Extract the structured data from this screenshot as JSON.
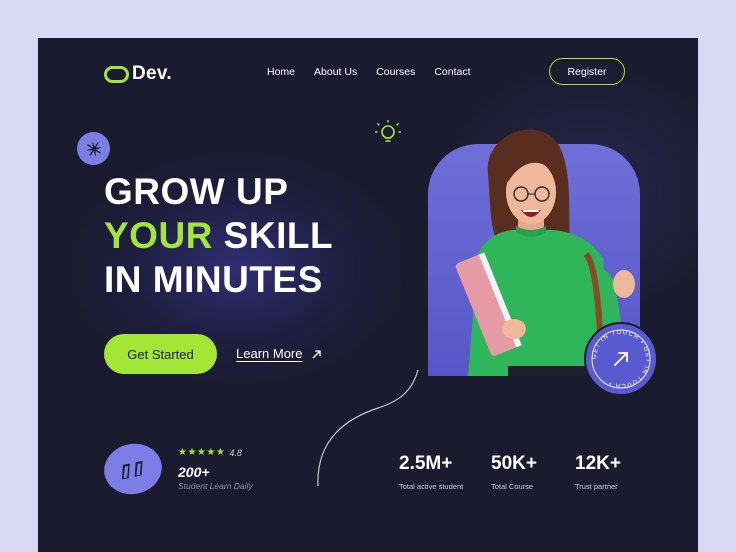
{
  "header": {
    "logo_text": "Dev.",
    "nav": [
      "Home",
      "About Us",
      "Courses",
      "Contact"
    ],
    "register_label": "Register"
  },
  "hero": {
    "line1": "GROW UP",
    "line2_accent": "YOUR",
    "line2_rest": " SKILL",
    "line3": "IN MINUTES",
    "cta_label": "Get Started",
    "learn_label": "Learn More",
    "badge_text": "GET IN TOUCH • GET IN TOUCH •"
  },
  "social_proof": {
    "stars": "★★★★★",
    "rating": "4.8",
    "count": "200+",
    "label": "Student Learn Daily"
  },
  "stats": [
    {
      "value": "2.5M+",
      "label": "Total active student"
    },
    {
      "value": "50K+",
      "label": "Total Course"
    },
    {
      "value": "12K+",
      "label": "Trust partner"
    }
  ],
  "colors": {
    "background": "#1b1b2f",
    "accent": "#a3e635",
    "purple": "#7d7de6"
  },
  "icons": [
    "sparkle-icon",
    "lightbulb-icon",
    "arrow-up-right-icon",
    "quote-icon"
  ]
}
